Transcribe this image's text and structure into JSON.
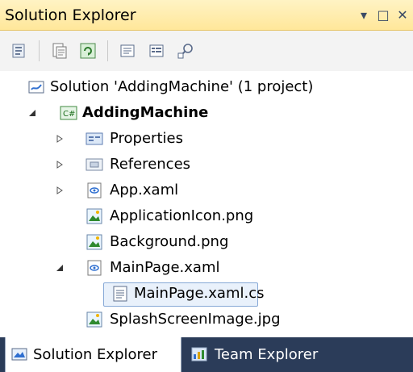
{
  "window": {
    "title": "Solution Explorer",
    "buttons": [
      "▾",
      "□",
      "✕"
    ]
  },
  "toolbar": {
    "items": [
      {
        "name": "properties-icon"
      },
      {
        "name": "show-all-files-icon"
      },
      {
        "name": "refresh-icon"
      },
      {
        "name": "view-code-icon"
      },
      {
        "name": "view-designer-icon"
      },
      {
        "name": "class-diagram-icon"
      }
    ]
  },
  "tree": {
    "solution": "Solution 'AddingMachine' (1 project)",
    "project": "AddingMachine",
    "items": [
      {
        "label": "Properties"
      },
      {
        "label": "References"
      },
      {
        "label": "App.xaml"
      },
      {
        "label": "ApplicationIcon.png"
      },
      {
        "label": "Background.png"
      },
      {
        "label": "MainPage.xaml"
      },
      {
        "label": "MainPage.xaml.cs"
      },
      {
        "label": "SplashScreenImage.jpg"
      }
    ]
  },
  "tabs": [
    {
      "label": "Solution Explorer"
    },
    {
      "label": "Team Explorer"
    }
  ],
  "colors": {
    "title_bg": "#ffe79a",
    "frame": "#2b3c59",
    "selection_border": "#86a8d6"
  }
}
